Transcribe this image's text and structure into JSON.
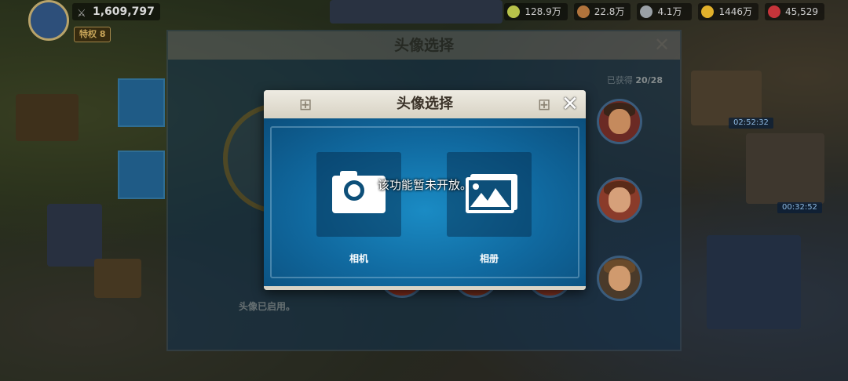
{
  "hud": {
    "power": "1,609,797",
    "vip": "特权 8",
    "resources": [
      {
        "icon": "food-icon",
        "value": "128.9万",
        "color": "#b7c24a"
      },
      {
        "icon": "wood-icon",
        "value": "22.8万",
        "color": "#b0733c"
      },
      {
        "icon": "stone-icon",
        "value": "4.1万",
        "color": "#9aa0a6"
      },
      {
        "icon": "gold-icon",
        "value": "1446万",
        "color": "#e2b12b"
      },
      {
        "icon": "gem-icon",
        "value": "45,529",
        "color": "#c6343a"
      }
    ]
  },
  "timers": [
    "02:52:32",
    "00:32:52"
  ],
  "background_panel": {
    "title": "头像选择",
    "obtained_label": "已获得",
    "obtained_count": "20/28",
    "status_text": "头像已启用。"
  },
  "modal": {
    "title": "头像选择",
    "options": [
      {
        "label": "相机",
        "icon": "camera-icon"
      },
      {
        "label": "相册",
        "icon": "gallery-icon"
      }
    ],
    "toast": "该功能暂未开放。"
  }
}
